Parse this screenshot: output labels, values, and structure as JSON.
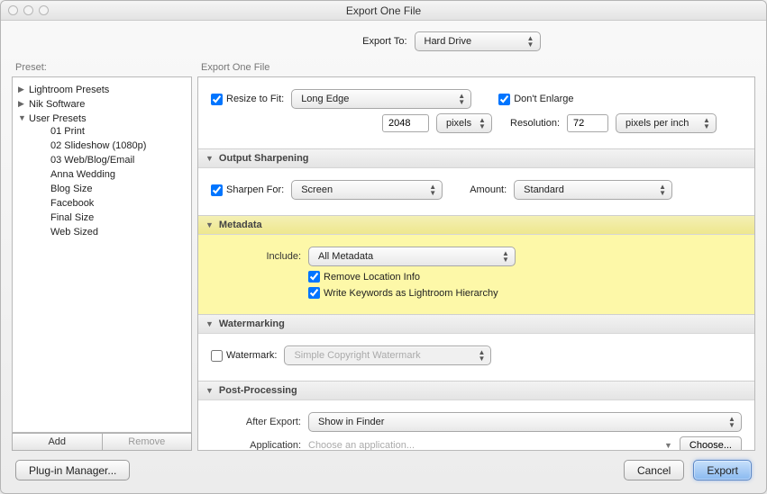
{
  "window": {
    "title": "Export One File"
  },
  "header": {
    "export_to_label": "Export To:",
    "export_to_value": "Hard Drive"
  },
  "sidebar": {
    "heading": "Preset:",
    "groups": [
      "Lightroom Presets",
      "Nik Software",
      "User Presets"
    ],
    "user_presets": [
      "01 Print",
      "02 Slideshow (1080p)",
      "03 Web/Blog/Email",
      "Anna Wedding",
      "Blog Size",
      "Facebook",
      "Final Size",
      "Web Sized"
    ],
    "add_label": "Add",
    "remove_label": "Remove"
  },
  "right": {
    "heading": "Export One File"
  },
  "sizing": {
    "resize_label": "Resize to Fit:",
    "resize_mode": "Long Edge",
    "dont_enlarge": "Don't Enlarge",
    "size_value": "2048",
    "size_unit": "pixels",
    "resolution_label": "Resolution:",
    "resolution_value": "72",
    "resolution_unit": "pixels per inch"
  },
  "sharpen": {
    "title": "Output Sharpening",
    "label": "Sharpen For:",
    "for_value": "Screen",
    "amount_label": "Amount:",
    "amount_value": "Standard"
  },
  "metadata": {
    "title": "Metadata",
    "include_label": "Include:",
    "include_value": "All Metadata",
    "remove_location": "Remove Location Info",
    "write_keywords": "Write Keywords as Lightroom Hierarchy"
  },
  "watermark": {
    "title": "Watermarking",
    "label": "Watermark:",
    "value": "Simple Copyright Watermark"
  },
  "post": {
    "title": "Post-Processing",
    "after_label": "After Export:",
    "after_value": "Show in Finder",
    "app_label": "Application:",
    "app_placeholder": "Choose an application...",
    "choose_label": "Choose..."
  },
  "footer": {
    "plugin_manager": "Plug-in Manager...",
    "cancel": "Cancel",
    "export": "Export"
  }
}
